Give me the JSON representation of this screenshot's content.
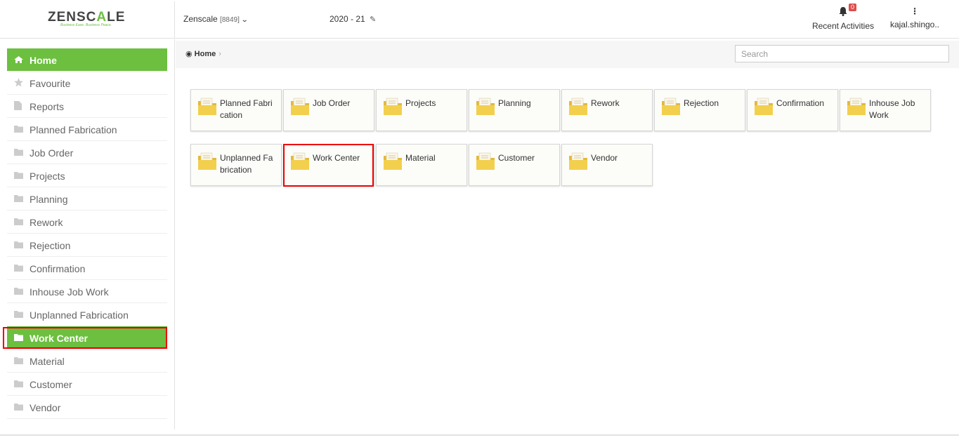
{
  "brand": {
    "logo_a": "ZENSC",
    "logo_b": "A",
    "logo_c": "LE",
    "tagline": "Business Ease. Business Peace.",
    "accent": "#6cbf3f"
  },
  "header": {
    "company": "Zenscale",
    "company_code": "[8849]",
    "year": "2020 - 21",
    "notifications": "0",
    "recent_label": "Recent Activities",
    "user": "kajal.shingo.."
  },
  "breadcrumb": {
    "home": "Home"
  },
  "search": {
    "placeholder": "Search"
  },
  "sidebar": {
    "items": [
      {
        "label": "Home"
      },
      {
        "label": "Favourite"
      },
      {
        "label": "Reports"
      },
      {
        "label": "Planned Fabrication"
      },
      {
        "label": "Job Order"
      },
      {
        "label": "Projects"
      },
      {
        "label": "Planning"
      },
      {
        "label": "Rework"
      },
      {
        "label": "Rejection"
      },
      {
        "label": "Confirmation"
      },
      {
        "label": "Inhouse Job Work"
      },
      {
        "label": "Unplanned Fabrication"
      },
      {
        "label": "Work Center"
      },
      {
        "label": "Material"
      },
      {
        "label": "Customer"
      },
      {
        "label": "Vendor"
      }
    ]
  },
  "tiles": [
    {
      "label": "Planned Fabrication"
    },
    {
      "label": "Job Order"
    },
    {
      "label": "Projects"
    },
    {
      "label": "Planning"
    },
    {
      "label": "Rework"
    },
    {
      "label": "Rejection"
    },
    {
      "label": "Confirmation"
    },
    {
      "label": "Inhouse Job Work"
    },
    {
      "label": "Unplanned Fabrication"
    },
    {
      "label": "Work Center"
    },
    {
      "label": "Material"
    },
    {
      "label": "Customer"
    },
    {
      "label": "Vendor"
    }
  ]
}
